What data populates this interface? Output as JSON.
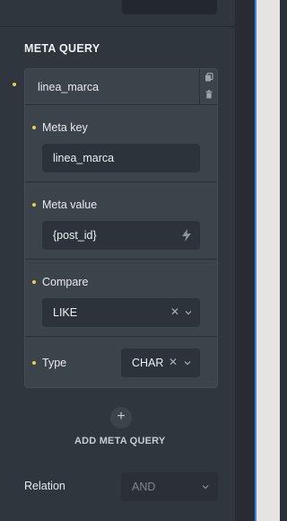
{
  "section": {
    "title": "META QUERY"
  },
  "query_item": {
    "header_title": "linea_marca",
    "icons": [
      "copy-icon",
      "trash-icon"
    ],
    "meta_key": {
      "label": "Meta key",
      "value": "linea_marca"
    },
    "meta_value": {
      "label": "Meta value",
      "value": "{post_id}",
      "suffix_icon": "lightning-icon"
    },
    "compare": {
      "label": "Compare",
      "value": "LIKE"
    },
    "type": {
      "label": "Type",
      "value": "CHAR"
    }
  },
  "add_button": {
    "icon": "plus-icon",
    "label": "ADD META QUERY"
  },
  "relation": {
    "label": "Relation",
    "placeholder": "AND"
  },
  "colors": {
    "accent_dot": "#f2c94c",
    "selection_line": "#3a82e8",
    "panel_bg": "#2f363d"
  }
}
